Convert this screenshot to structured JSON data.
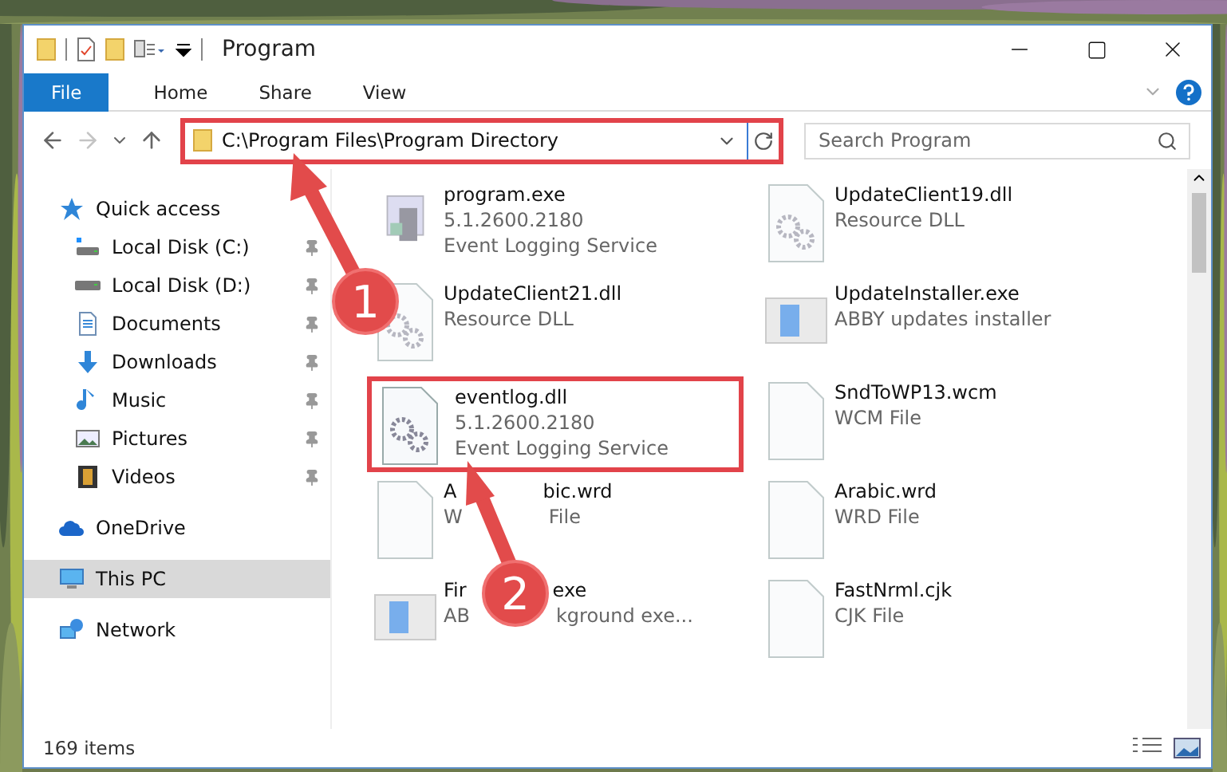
{
  "window": {
    "title": "Program"
  },
  "ribbon_tabs": [
    {
      "label": "File",
      "kind": "file"
    },
    {
      "label": "Home",
      "kind": "tab"
    },
    {
      "label": "Share",
      "kind": "tab"
    },
    {
      "label": "View",
      "kind": "tab"
    }
  ],
  "address": {
    "path": "C:\\Program Files\\Program Directory",
    "highlighted": true
  },
  "search": {
    "placeholder": "Search Program"
  },
  "nav": [
    {
      "label": "Quick access",
      "kind": "star",
      "selected": false,
      "children": [
        {
          "label": "Local Disk (C:)",
          "kind": "system-drive",
          "pinned": true
        },
        {
          "label": "Local Disk (D:)",
          "kind": "drive",
          "pinned": true
        },
        {
          "label": "Documents",
          "kind": "document",
          "pinned": true
        },
        {
          "label": "Downloads",
          "kind": "download",
          "pinned": true
        },
        {
          "label": "Music",
          "kind": "music",
          "pinned": true
        },
        {
          "label": "Pictures",
          "kind": "pictures",
          "pinned": true
        },
        {
          "label": "Videos",
          "kind": "videos",
          "pinned": true
        }
      ]
    },
    {
      "label": "OneDrive",
      "kind": "cloud",
      "selected": false
    },
    {
      "label": "This PC",
      "kind": "pc",
      "selected": true
    },
    {
      "label": "Network",
      "kind": "network",
      "selected": false
    }
  ],
  "files": [
    {
      "name": "program.exe",
      "lines": [
        "5.1.2600.2180",
        "Event Logging Service"
      ],
      "kind": "app",
      "highlighted": false
    },
    {
      "name": "UpdateClient19.dll",
      "lines": [
        "Resource DLL"
      ],
      "kind": "gears",
      "highlighted": false
    },
    {
      "name": "UpdateClient21.dll",
      "lines": [
        "Resource DLL"
      ],
      "kind": "gears",
      "highlighted": false
    },
    {
      "name": "UpdateInstaller.exe",
      "lines": [
        "ABBY updates installer"
      ],
      "kind": "window",
      "highlighted": false
    },
    {
      "name": "eventlog.dll",
      "lines": [
        "5.1.2600.2180",
        "Event Logging Service"
      ],
      "kind": "gears",
      "highlighted": true
    },
    {
      "name": "SndToWP13.wcm",
      "lines": [
        "WCM File"
      ],
      "kind": "page",
      "highlighted": false
    },
    {
      "name_parts": [
        "A",
        "bic.wrd"
      ],
      "line_parts": [
        [
          "W",
          "File"
        ]
      ],
      "kind": "page",
      "highlighted": false
    },
    {
      "name": "Arabic.wrd",
      "lines": [
        "WRD File"
      ],
      "kind": "page",
      "highlighted": false
    },
    {
      "name_parts": [
        "Fir",
        "exe"
      ],
      "line_parts": [
        [
          "AB",
          "kground exe..."
        ]
      ],
      "kind": "window",
      "highlighted": false
    },
    {
      "name": "FastNrml.cjk",
      "lines": [
        "CJK File"
      ],
      "kind": "page",
      "highlighted": false
    }
  ],
  "status_bar": {
    "count": "169 items"
  },
  "annotations": [
    {
      "number": "1"
    },
    {
      "number": "2"
    }
  ]
}
